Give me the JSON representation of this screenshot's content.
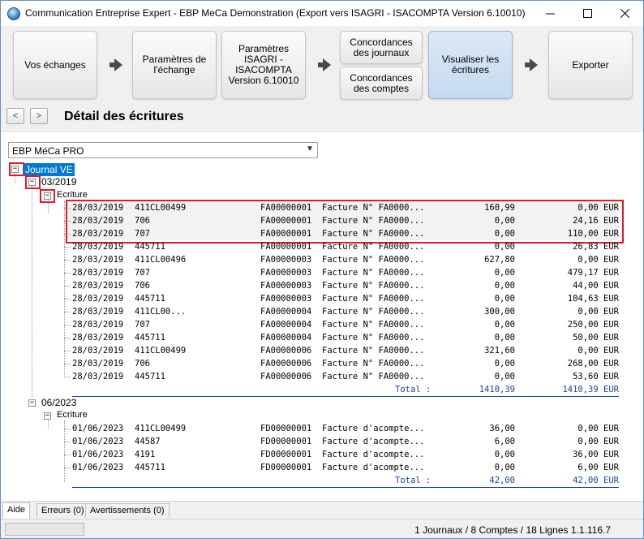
{
  "window": {
    "title": "Communication Entreprise Expert - EBP MeCa Demonstration (Export vers ISAGRI - ISACOMPTA Version 6.10010)",
    "min_icon": "minimize-icon",
    "max_icon": "maximize-icon",
    "close_icon": "close-icon"
  },
  "steps": {
    "vos_echanges": "Vos échanges",
    "parametres_echange": "Paramètres de l'échange",
    "parametres_isagri": "Paramètres ISAGRI - ISACOMPTA Version 6.10010",
    "concordances_journaux": "Concordances des journaux",
    "concordances_comptes": "Concordances des comptes",
    "visualiser": "Visualiser les écritures",
    "exporter": "Exporter"
  },
  "nav": {
    "back": "<",
    "forward": ">",
    "page_title": "Détail des écritures"
  },
  "combo": {
    "selected": "EBP MéCa PRO"
  },
  "tree": {
    "journal": "Journal VE",
    "period1": "03/2019",
    "period1_group": "Ecriture",
    "period2": "06/2023",
    "period2_group": "Ecriture"
  },
  "rows_2019": [
    {
      "date": "28/03/2019",
      "acct": "411CL00499",
      "piece": "FA00000001",
      "lib": "Facture N° FA0000...",
      "debit": "160,99",
      "credit": "0,00 EUR"
    },
    {
      "date": "28/03/2019",
      "acct": "706",
      "piece": "FA00000001",
      "lib": "Facture N° FA0000...",
      "debit": "0,00",
      "credit": "24,16 EUR"
    },
    {
      "date": "28/03/2019",
      "acct": "707",
      "piece": "FA00000001",
      "lib": "Facture N° FA0000...",
      "debit": "0,00",
      "credit": "110,00 EUR"
    },
    {
      "date": "28/03/2019",
      "acct": "445711",
      "piece": "FA00000001",
      "lib": "Facture N° FA0000...",
      "debit": "0,00",
      "credit": "26,83 EUR"
    },
    {
      "date": "28/03/2019",
      "acct": "411CL00496",
      "piece": "FA00000003",
      "lib": "Facture N° FA0000...",
      "debit": "627,80",
      "credit": "0,00 EUR"
    },
    {
      "date": "28/03/2019",
      "acct": "707",
      "piece": "FA00000003",
      "lib": "Facture N° FA0000...",
      "debit": "0,00",
      "credit": "479,17 EUR"
    },
    {
      "date": "28/03/2019",
      "acct": "706",
      "piece": "FA00000003",
      "lib": "Facture N° FA0000...",
      "debit": "0,00",
      "credit": "44,00 EUR"
    },
    {
      "date": "28/03/2019",
      "acct": "445711",
      "piece": "FA00000003",
      "lib": "Facture N° FA0000...",
      "debit": "0,00",
      "credit": "104,63 EUR"
    },
    {
      "date": "28/03/2019",
      "acct": "411CL00...",
      "piece": "FA00000004",
      "lib": "Facture N° FA0000...",
      "debit": "300,00",
      "credit": "0,00 EUR"
    },
    {
      "date": "28/03/2019",
      "acct": "707",
      "piece": "FA00000004",
      "lib": "Facture N° FA0000...",
      "debit": "0,00",
      "credit": "250,00 EUR"
    },
    {
      "date": "28/03/2019",
      "acct": "445711",
      "piece": "FA00000004",
      "lib": "Facture N° FA0000...",
      "debit": "0,00",
      "credit": "50,00 EUR"
    },
    {
      "date": "28/03/2019",
      "acct": "411CL00499",
      "piece": "FA00000006",
      "lib": "Facture N° FA0000...",
      "debit": "321,60",
      "credit": "0,00 EUR"
    },
    {
      "date": "28/03/2019",
      "acct": "706",
      "piece": "FA00000006",
      "lib": "Facture N° FA0000...",
      "debit": "0,00",
      "credit": "268,00 EUR"
    },
    {
      "date": "28/03/2019",
      "acct": "445711",
      "piece": "FA00000006",
      "lib": "Facture N° FA0000...",
      "debit": "0,00",
      "credit": "53,60 EUR"
    }
  ],
  "total_2019": {
    "label": "Total :",
    "debit": "1410,39",
    "credit": "1410,39 EUR"
  },
  "rows_2023": [
    {
      "date": "01/06/2023",
      "acct": "411CL00499",
      "piece": "FD00000001",
      "lib": "Facture d'acompte...",
      "debit": "36,00",
      "credit": "0,00 EUR"
    },
    {
      "date": "01/06/2023",
      "acct": "44587",
      "piece": "FD00000001",
      "lib": "Facture d'acompte...",
      "debit": "6,00",
      "credit": "0,00 EUR"
    },
    {
      "date": "01/06/2023",
      "acct": "4191",
      "piece": "FD00000001",
      "lib": "Facture d'acompte...",
      "debit": "0,00",
      "credit": "36,00 EUR"
    },
    {
      "date": "01/06/2023",
      "acct": "445711",
      "piece": "FD00000001",
      "lib": "Facture d'acompte...",
      "debit": "0,00",
      "credit": "6,00 EUR"
    }
  ],
  "total_2023": {
    "label": "Total :",
    "debit": "42,00",
    "credit": "42,00 EUR"
  },
  "tabs": {
    "aide": "Aide",
    "erreurs": "Erreurs (0)",
    "avertissements": "Avertissements (0)"
  },
  "status": {
    "summary": "1 Journaux / 8 Comptes / 18 Lignes   1.1.116.7"
  },
  "colors": {
    "highlight": "#e01b24",
    "selection": "#0078d7",
    "total": "#1a3fa8"
  }
}
